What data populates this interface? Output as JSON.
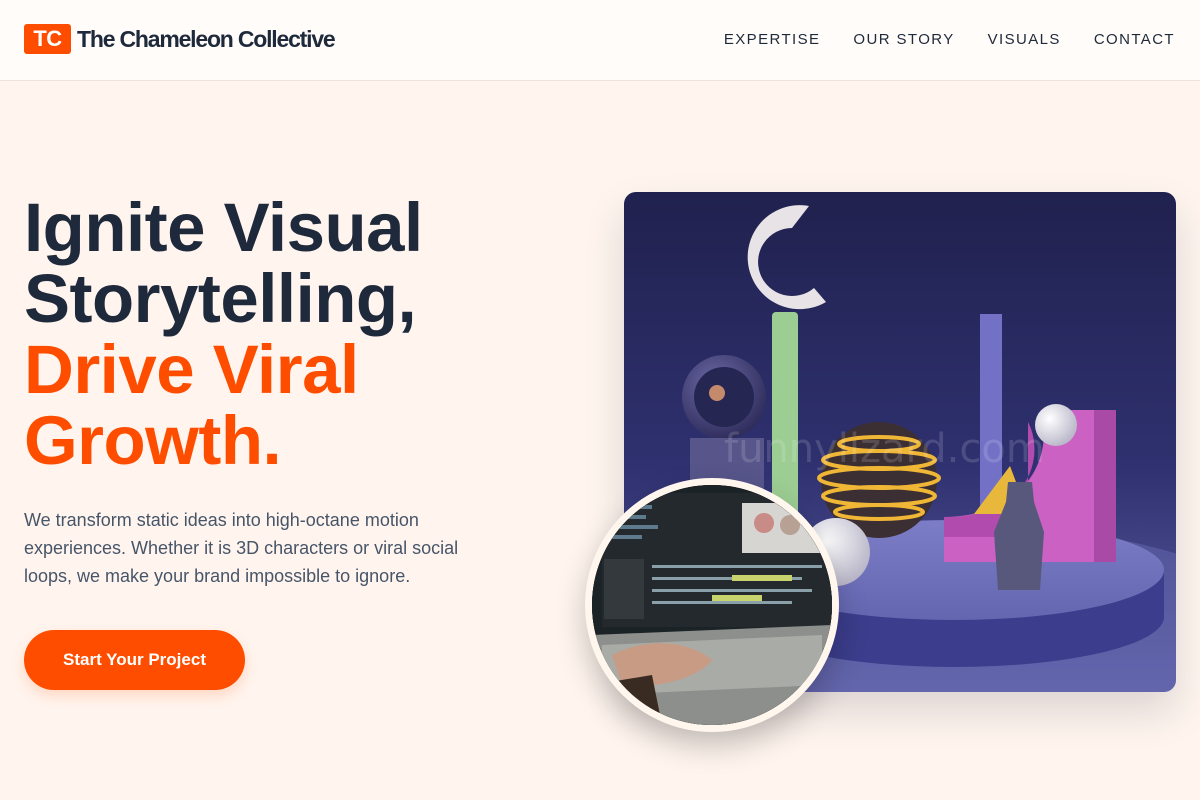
{
  "brand": {
    "badge": "TC",
    "name": "The Chameleon Collective"
  },
  "nav": {
    "items": [
      "EXPERTISE",
      "OUR STORY",
      "VISUALS",
      "CONTACT"
    ]
  },
  "hero": {
    "headline_line1": "Ignite Visual",
    "headline_line2": "Storytelling,",
    "headline_line3": "Drive Viral",
    "headline_line4": "Growth.",
    "subtext": "We transform static ideas into high-octane motion experiences. Whether it is 3D characters or viral social loops, we make your brand impossible to ignore.",
    "cta_label": "Start Your Project"
  },
  "visuals": {
    "watermark": "funnylizard.com"
  },
  "colors": {
    "accent": "#ff4d00",
    "dark": "#1e293b",
    "background": "#fff5ee"
  }
}
